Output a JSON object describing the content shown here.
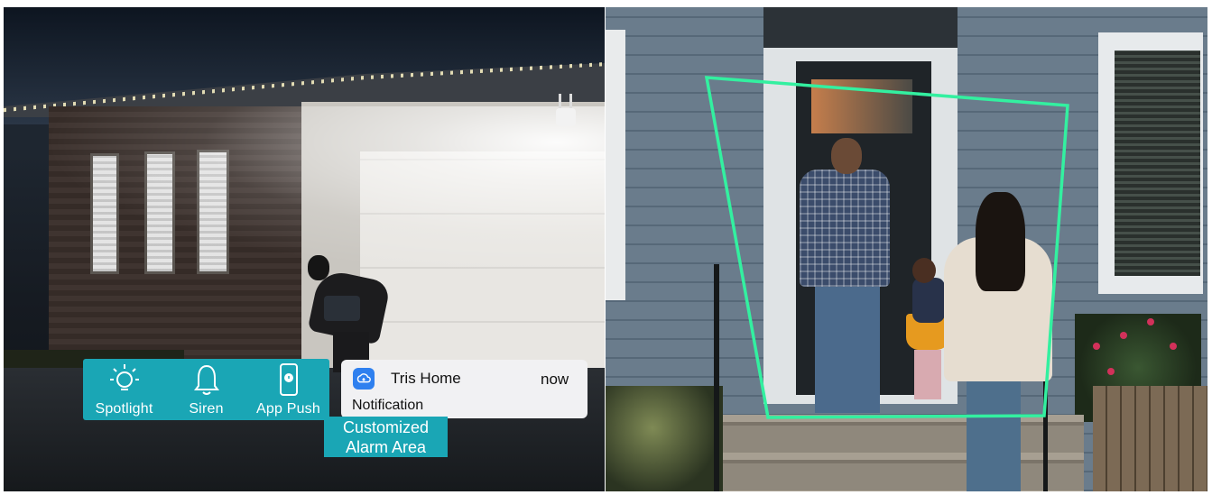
{
  "left_scene": {
    "features": [
      {
        "icon": "spotlight-icon",
        "label": "Spotlight"
      },
      {
        "icon": "siren-icon",
        "label": "Siren"
      },
      {
        "icon": "app-push-icon",
        "label": "App Push"
      }
    ],
    "notification": {
      "app_name": "Tris Home",
      "time": "now",
      "body": "Notification",
      "icon": "cloud-icon"
    }
  },
  "right_scene": {
    "alarm_area_label": [
      "Customized",
      "Alarm Area"
    ]
  },
  "colors": {
    "accent_teal": "#1aa6b5",
    "alarm_outline": "#33f0a0",
    "notification_icon": "#2f80ef"
  }
}
